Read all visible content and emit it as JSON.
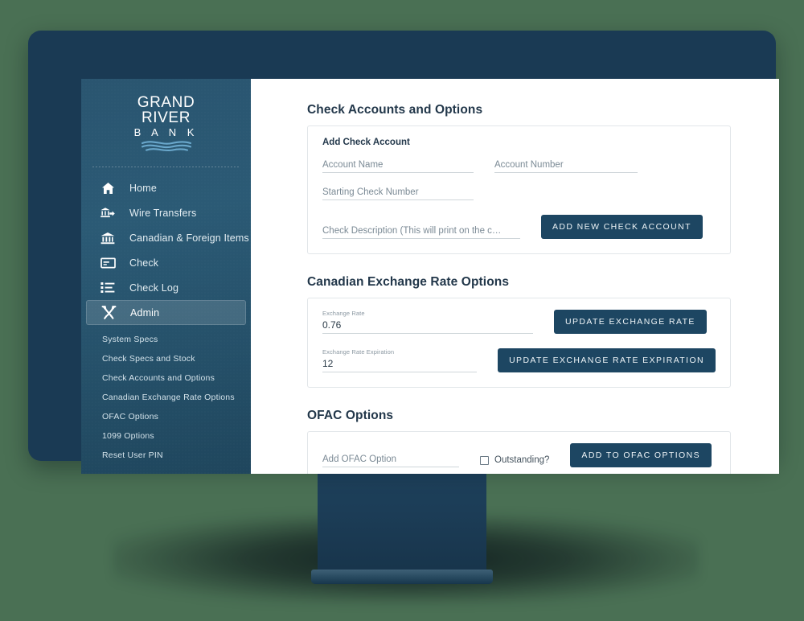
{
  "colors": {
    "page_background": "#4a7054",
    "monitor_bezel": "#1a3a54",
    "sidebar_gradient_top": "#2a5570",
    "sidebar_gradient_bottom": "#1f465d",
    "button_navy": "#1d4662",
    "heading_navy": "#22374a",
    "logo_wave_blue": "#6aa8cc"
  },
  "sidebar": {
    "logo": {
      "line1": "GRAND",
      "line2": "RIVER",
      "line3": "B A N K"
    },
    "nav": [
      {
        "label": "Home",
        "icon": "home-icon",
        "active": false
      },
      {
        "label": "Wire Transfers",
        "icon": "bank-transfer-icon",
        "active": false
      },
      {
        "label": "Canadian & Foreign Items",
        "icon": "bank-icon",
        "active": false
      },
      {
        "label": "Check",
        "icon": "check-card-icon",
        "active": false
      },
      {
        "label": "Check Log",
        "icon": "list-icon",
        "active": false
      },
      {
        "label": "Admin",
        "icon": "tools-icon",
        "active": true
      }
    ],
    "subnav": [
      {
        "label": "System Specs"
      },
      {
        "label": "Check Specs and Stock"
      },
      {
        "label": "Check Accounts and Options"
      },
      {
        "label": "Canadian Exchange Rate Options"
      },
      {
        "label": "OFAC Options"
      },
      {
        "label": "1099 Options"
      },
      {
        "label": "Reset User PIN"
      }
    ]
  },
  "main": {
    "check_accounts": {
      "section_title": "Check Accounts and Options",
      "card_title": "Add Check Account",
      "account_name_placeholder": "Account Name",
      "account_number_placeholder": "Account Number",
      "starting_check_number_placeholder": "Starting Check Number",
      "check_description_placeholder": "Check Description (This will print on the c…",
      "add_button_label": "ADD NEW CHECK ACCOUNT"
    },
    "exchange_rate": {
      "section_title": "Canadian Exchange Rate Options",
      "rate_label": "Exchange Rate",
      "rate_value": "0.76",
      "update_rate_button_label": "UPDATE EXCHANGE RATE",
      "expiration_label": "Exchange Rate Expiration",
      "expiration_value": "12",
      "update_expiration_button_label": "UPDATE EXCHANGE RATE EXPIRATION"
    },
    "ofac": {
      "section_title": "OFAC Options",
      "add_option_placeholder": "Add OFAC Option",
      "outstanding_checkbox_label": "Outstanding?",
      "outstanding_checked": false,
      "add_button_label": "ADD TO OFAC OPTIONS"
    }
  }
}
